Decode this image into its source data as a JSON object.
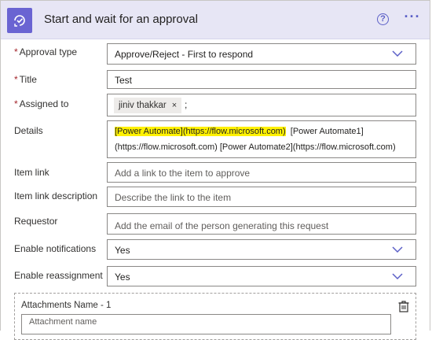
{
  "header": {
    "title": "Start and wait for an approval",
    "help_icon": "?",
    "more_icon": "···",
    "icon_name": "approval-icon",
    "accent": "#6a64d2"
  },
  "fields": {
    "approval_type": {
      "label": "Approval type",
      "required": "*",
      "value": "Approve/Reject - First to respond"
    },
    "title": {
      "label": "Title",
      "required": "*",
      "value": "Test"
    },
    "assigned_to": {
      "label": "Assigned to",
      "required": "*",
      "tag": "jiniv thakkar",
      "tag_remove": "×",
      "separator": ";"
    },
    "details": {
      "label": "Details",
      "highlighted": "[Power Automate](https://flow.microsoft.com)",
      "line1_rest": "[Power Automate1]",
      "line2": "(https://flow.microsoft.com)  [Power Automate2](https://flow.microsoft.com)"
    },
    "item_link": {
      "label": "Item link",
      "placeholder": "Add a link to the item to approve"
    },
    "item_link_description": {
      "label": "Item link description",
      "placeholder": "Describe the link to the item"
    },
    "requestor": {
      "label": "Requestor",
      "placeholder": "Add the email of the person generating this request"
    },
    "enable_notifications": {
      "label": "Enable notifications",
      "value": "Yes"
    },
    "enable_reassignment": {
      "label": "Enable reassignment",
      "value": "Yes"
    }
  },
  "attachments": {
    "label": "Attachments Name - 1",
    "placeholder": "Attachment name"
  }
}
